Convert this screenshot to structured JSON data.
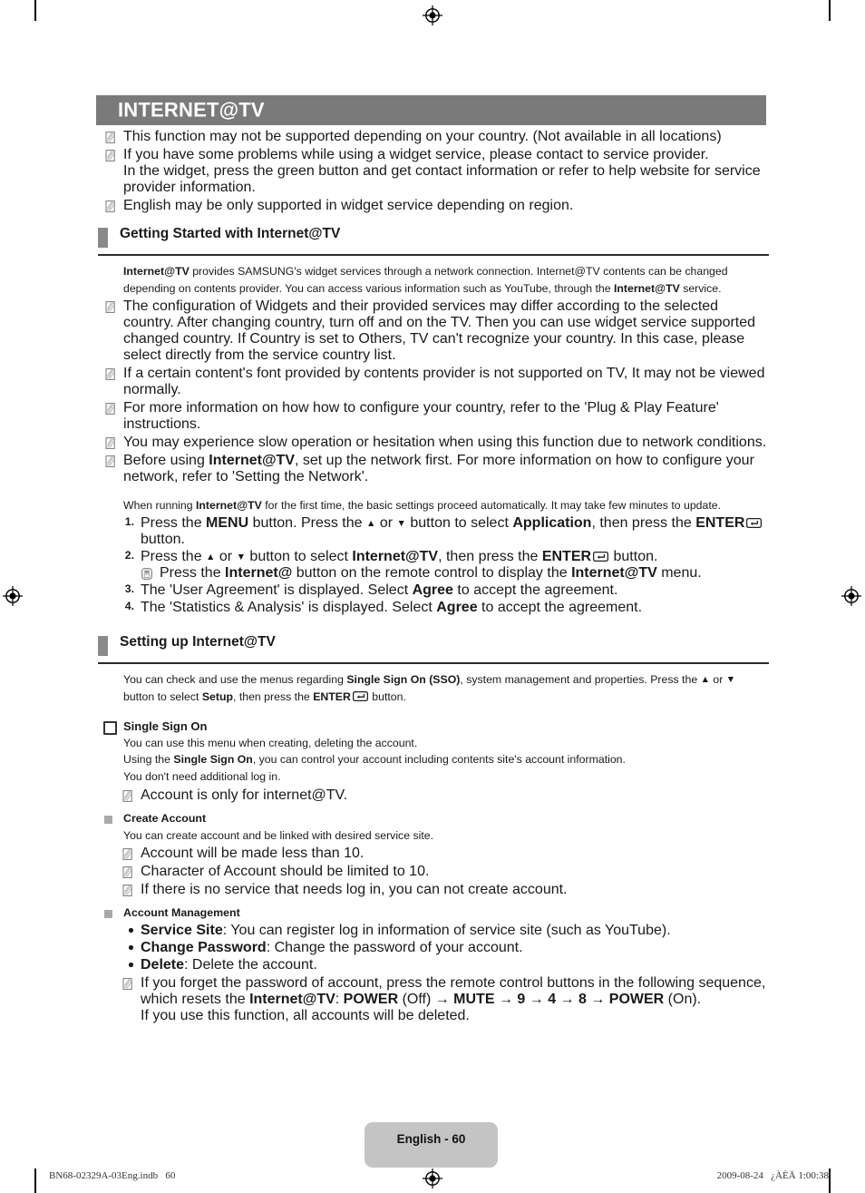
{
  "chapter": {
    "title": "INTERNET@TV"
  },
  "intro_notes": [
    "This function may not be supported depending on your country. (Not available in all locations)",
    "If you have some problems while using a widget service, please contact to service provider.",
    "In the widget, press the green button and get contact information or refer to help website for service provider information.",
    "English may be only supported in widget service depending on region."
  ],
  "section1": {
    "heading": "Getting Started with Internet@TV",
    "intro_a": "Internet@TV",
    "intro_b": " provides SAMSUNG's widget services through a network connection. Internet@TV contents can be changed depending on contents provider. You can access various information such as YouTube, through the ",
    "intro_c": "Internet@TV",
    "intro_d": " service.",
    "note1": "The configuration of Widgets and their provided services may differ according to the selected country. After changing country, turn off and on the TV. Then you can use widget service supported changed country. If Country is set to Others, TV can't recognize your country. In this case, please select directly from the service country list.",
    "note2": "If a certain content's font provided by contents provider is not supported on TV, It may not be viewed normally.",
    "note3": "For more information on how how to configure your country, refer to the 'Plug & Play Feature' instructions.",
    "note4": "You may experience slow operation or hesitation when using this function due to network conditions.",
    "note5_a": "Before using ",
    "note5_b": "Internet@TV",
    "note5_c": ", set up the network first. For more information on how to configure your network, refer to 'Setting the Network'.",
    "running_a": "When running ",
    "running_b": "Internet@TV",
    "running_c": " for the first time, the basic settings proceed automatically. It may take few minutes to update.",
    "steps": [
      {
        "num": "1.",
        "p1": "Press the ",
        "b1": "MENU",
        "p2": " button. Press the ",
        "arrow_up": "▲",
        "p3": " or ",
        "arrow_down": "▼",
        "p4": " button to select ",
        "b2": "Application",
        "p5": ", then press the ",
        "b3": "ENTER",
        "p6": " button."
      },
      {
        "num": "2.",
        "p1": "Press the ",
        "arrow_up": "▲",
        "p3": " or ",
        "arrow_down": "▼",
        "p4": " button to select ",
        "b2": "Internet@TV",
        "p5": ", then press the ",
        "b3": "ENTER",
        "p6": " button."
      },
      {
        "num": "3.",
        "p1": "The 'User Agreement' is displayed. Select ",
        "b2": "Agree",
        "p5": " to accept the agreement."
      },
      {
        "num": "4.",
        "p1": "The 'Statistics & Analysis' is displayed. Select ",
        "b2": "Agree",
        "p5": " to accept the agreement."
      }
    ],
    "remote_note_a": "Press the ",
    "remote_note_b": "Internet@",
    "remote_note_c": " button on the remote control to display the ",
    "remote_note_d": "Internet@TV",
    "remote_note_e": " menu."
  },
  "section2": {
    "heading": "Setting up Internet@TV",
    "intro_a": "You can check and use the menus regarding ",
    "intro_b": "Single Sign On (SSO)",
    "intro_c": ", system management and properties. Press the ",
    "arrow_up": "▲",
    "intro_d": " or ",
    "arrow_down": "▼",
    "intro_e": " button to select ",
    "intro_f": "Setup",
    "intro_g": ", then press the ",
    "intro_h": "ENTER",
    "intro_i": " button.",
    "sso": {
      "title": "Single Sign On",
      "line1": "You can use this menu when creating, deleting the account.",
      "line2_a": "Using the ",
      "line2_b": "Single Sign On",
      "line2_c": ", you can control your account including contents site's account information.",
      "line3": "You don't need additional log in.",
      "note1": "Account is only for internet@TV."
    },
    "create_account": {
      "title": "Create Account",
      "line1": "You can create account and be linked with desired service site.",
      "note1": "Account will be made less than 10.",
      "note2": "Character of Account should be limited to 10.",
      "note3": "If there is no service that needs log in, you can not create account."
    },
    "account_management": {
      "title": "Account Management",
      "bullets": [
        {
          "label": "Service Site",
          "text": ": You can register log in information of service site (such as YouTube)."
        },
        {
          "label": "Change Password",
          "text": ": Change the password of your account."
        },
        {
          "label": "Delete",
          "text": ": Delete the account."
        }
      ],
      "note1_a": "If you forget the password of account, press the remote control buttons in the following sequence, which resets the ",
      "note1_b": "Internet@TV",
      "note1_c": ": ",
      "note1_power1": "POWER",
      "note1_off": " (Off) → ",
      "note1_mute": "MUTE",
      "note1_arrow1": " → ",
      "note1_n9": "9",
      "note1_arrow2": " → ",
      "note1_n4": "4",
      "note1_arrow3": " → ",
      "note1_n8": "8",
      "note1_arrow4": " → ",
      "note1_power2": "POWER",
      "note1_on": " (On).",
      "note1_line2": "If you use this function, all accounts will be deleted."
    }
  },
  "footer": {
    "page_label": "English - 60",
    "file_ref": "BN68-02329A-03Eng.indb   60",
    "timestamp": "2009-08-24   ¿ÀÈÄ 1:00:38"
  },
  "colors": {
    "chapter_bar": "#7a7a7a",
    "section_tab": "#8a8a8a",
    "badge": "#c4c4c4",
    "bullet_square": "#a9a9a9"
  }
}
